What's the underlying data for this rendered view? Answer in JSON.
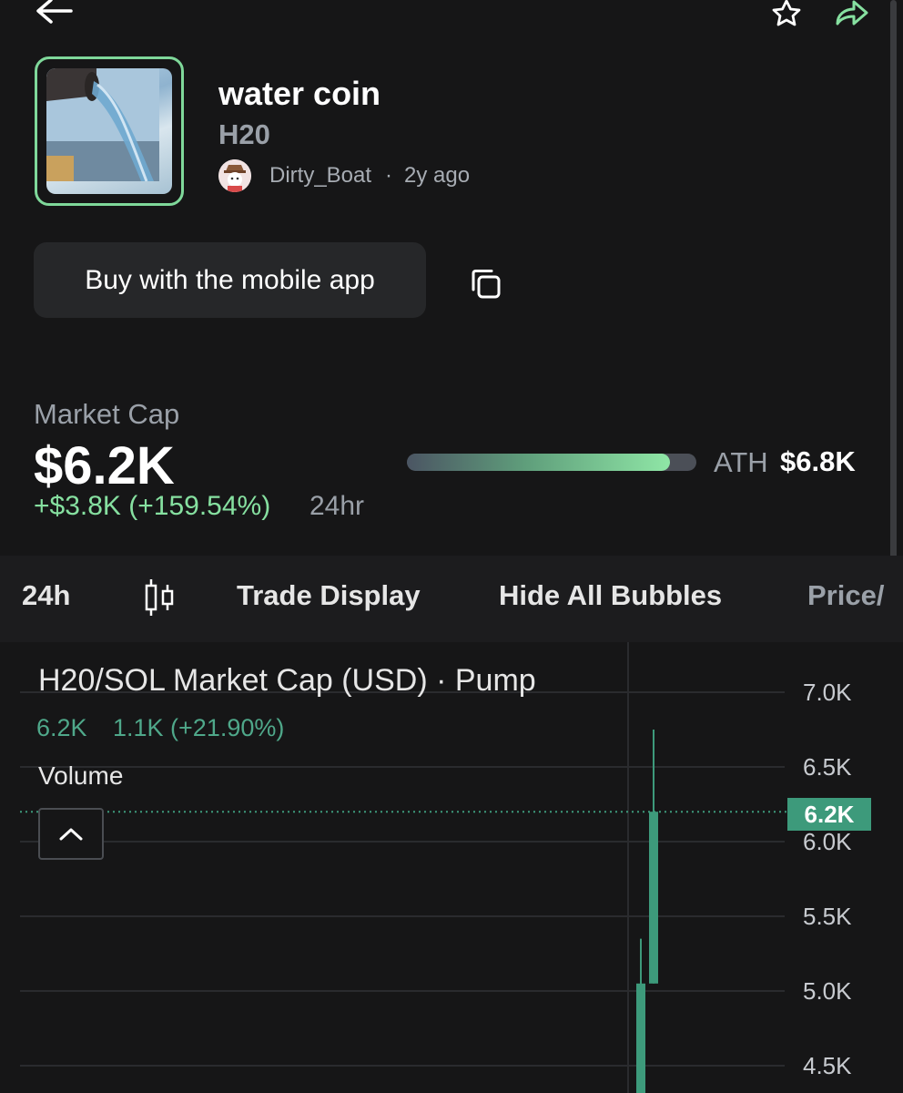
{
  "icons": {
    "back": "arrow-left-icon",
    "favorite": "star-icon",
    "share": "share-icon",
    "copy": "copy-icon",
    "candle": "candlestick-icon",
    "collapse": "chevron-up-icon"
  },
  "coin": {
    "name": "water coin",
    "ticker": "H20",
    "creator": "Dirty_Boat",
    "separator": "·",
    "created_ago": "2y ago"
  },
  "actions": {
    "buy_label": "Buy with the mobile app"
  },
  "market": {
    "label": "Market Cap",
    "value": "$6.2K",
    "change": "+$3.8K (+159.54%)",
    "period": "24hr",
    "ath_label": "ATH",
    "ath_value": "$6.8K",
    "ath_progress": 0.91
  },
  "toolbar": {
    "interval": "24h",
    "trade_display": "Trade Display",
    "hide_bubbles": "Hide All Bubbles",
    "price_partial": "Price/"
  },
  "chart": {
    "title": "H20/SOL Market Cap (USD) · Pump",
    "last_value": "6.2K",
    "change_text": "1.1K (+21.90%)",
    "volume_label": "Volume",
    "current_badge": "6.2K",
    "colors": {
      "up": "#3d9a7b",
      "accent": "#86e0a0",
      "grid": "#2a2b2e"
    }
  },
  "chart_data": {
    "type": "candlestick",
    "title": "H20/SOL Market Cap (USD) · Pump",
    "y_ticks": [
      "7.0K",
      "6.5K",
      "6.0K",
      "5.5K",
      "5.0K",
      "4.5K"
    ],
    "ylim": [
      4.3,
      7.3
    ],
    "current_value": 6.2,
    "candles": [
      {
        "open": 4.0,
        "close": 5.05,
        "high": 5.35,
        "low": 4.0
      },
      {
        "open": 5.05,
        "close": 6.2,
        "high": 6.75,
        "low": 5.05
      }
    ]
  }
}
